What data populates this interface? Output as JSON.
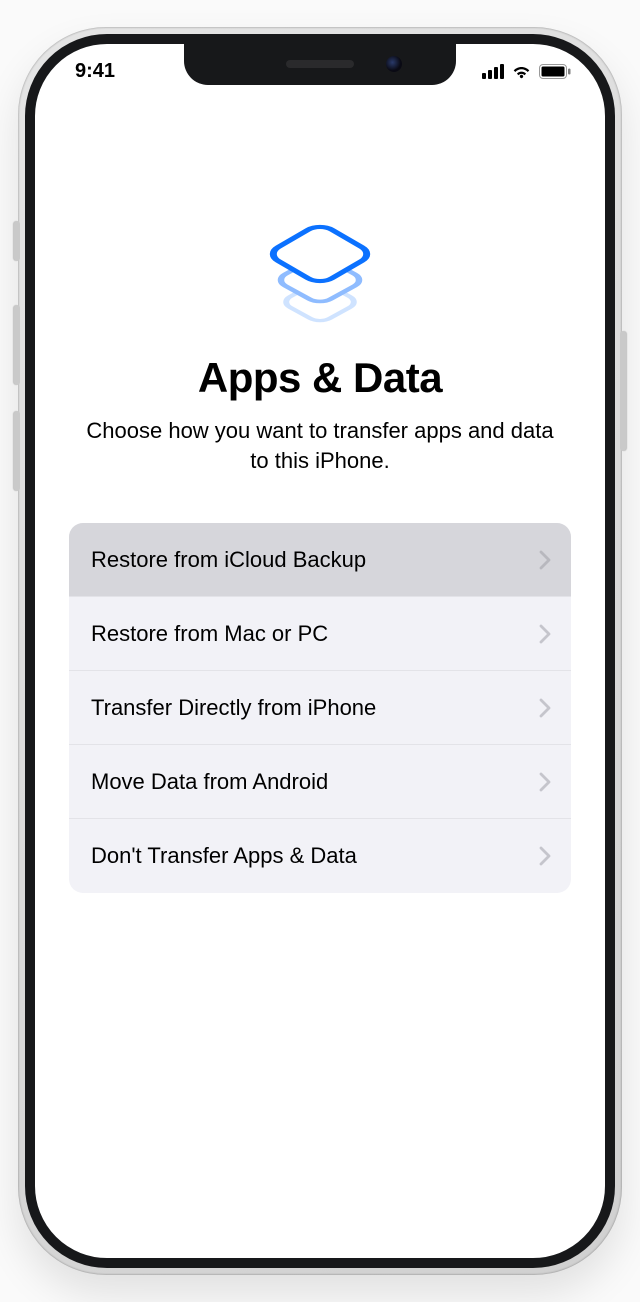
{
  "status": {
    "time": "9:41"
  },
  "page": {
    "title": "Apps & Data",
    "subtitle": "Choose how you want to transfer apps and data to this iPhone."
  },
  "options": [
    {
      "label": "Restore from iCloud Backup",
      "selected": true
    },
    {
      "label": "Restore from Mac or PC",
      "selected": false
    },
    {
      "label": "Transfer Directly from iPhone",
      "selected": false
    },
    {
      "label": "Move Data from Android",
      "selected": false
    },
    {
      "label": "Don't Transfer Apps & Data",
      "selected": false
    }
  ]
}
